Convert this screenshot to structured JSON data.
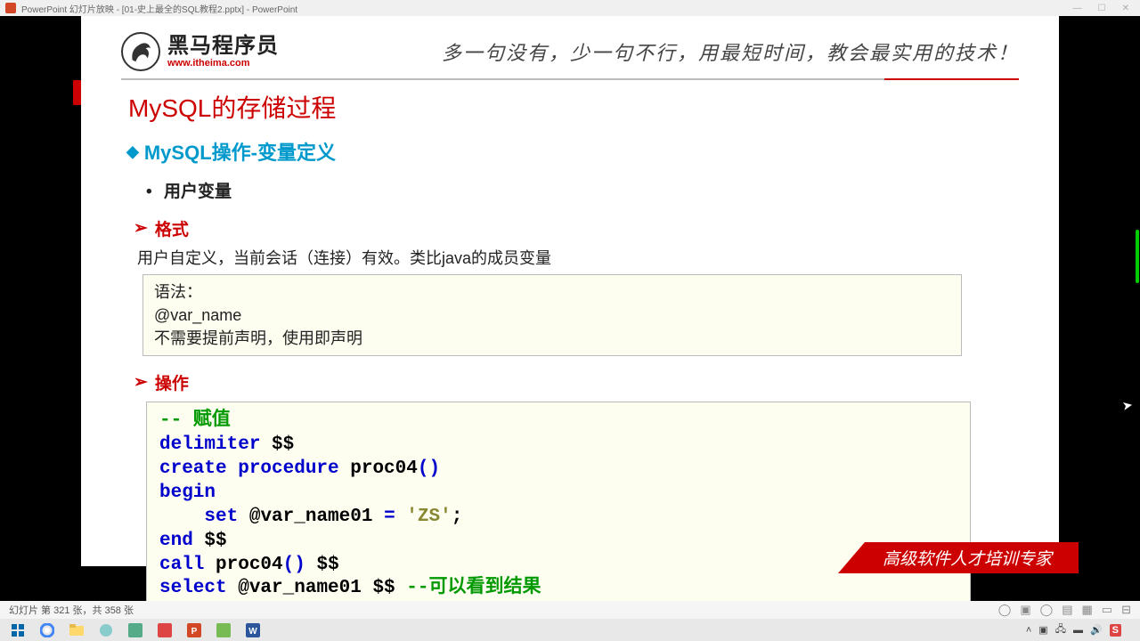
{
  "titlebar": {
    "text": "PowerPoint 幻灯片放映 - [01-史上最全的SQL教程2.pptx] - PowerPoint"
  },
  "logo": {
    "cn": "黑马程序员",
    "url": "www.itheima.com"
  },
  "slogan": "多一句没有，少一句不行，用最短时间，教会最实用的技术！",
  "title": "MySQL的存储过程",
  "subtitle": "MySQL操作-变量定义",
  "bullet1": "用户变量",
  "sec_format": "格式",
  "desc1": "用户自定义，当前会话（连接）有效。类比java的成员变量",
  "syntax": {
    "l1": "语法：",
    "l2": "@var_name",
    "l3": "不需要提前声明，使用即声明"
  },
  "sec_op": "操作",
  "code": {
    "c1": "-- 赋值",
    "l2a": "delimiter",
    "l2b": " $$",
    "l3a": "create procedure",
    "l3b": " proc04",
    "l3c": "()",
    "l4": "begin",
    "l5a": "set",
    "l5b": " @var_name01  ",
    "l5c": "=",
    "l5d": " 'ZS'",
    "l5e": ";",
    "l6a": "end",
    "l6b": " $$",
    "l7a": "call",
    "l7b": " proc04",
    "l7c": "()",
    "l7d": " $$",
    "l8a": "select",
    "l8b": " @var_name01  $$  ",
    "l8c": "--可以看到结果"
  },
  "footer": "高级软件人才培训专家",
  "status": {
    "left": "幻灯片 第 321 张，共 358 张"
  },
  "tray": {
    "time": ""
  }
}
